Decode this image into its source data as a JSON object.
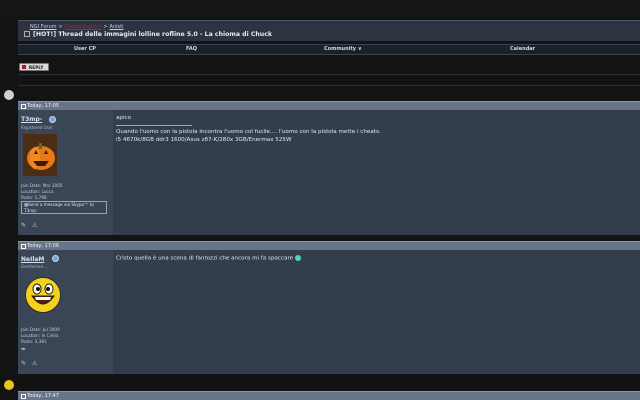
{
  "breadcrumb": {
    "forum": "NGI Forum",
    "section": "Comunicazioni",
    "subsection": "Anisti"
  },
  "thread": {
    "title": "[HOT!] Thread delle immagini lolline rofline 5.0 - La chioma di Chuck"
  },
  "navbar": {
    "items": [
      "User CP",
      "FAQ",
      "Community",
      "Calendar"
    ]
  },
  "actions": {
    "reply_label": "REPLY"
  },
  "colors": {
    "accent": "#c0163c",
    "post_header": "#67758a",
    "userinfo_bg": "#3a4555",
    "post_bg": "#333e4c"
  },
  "posts": [
    {
      "date": "Today, 17:05",
      "username": "T3mp-",
      "user_title": "Registered User",
      "avatar": "pumpkin-avatar",
      "join_date": "Join Date: Mar 2005",
      "location": "Location: Lucca",
      "posts": "Posts: 1,798",
      "skype_label": "Send a message via Skype™ to T3mp-",
      "body": [
        "apico",
        "Quando l'uomo con la pistola incontra l'uomo col fucile.... l'uomo con la pistola mette i cheats.",
        "i5 4670k/8GB ddr3 1600/Asus z87-K/280x 3GB/Enermax 525W"
      ]
    },
    {
      "date": "Today, 17:06",
      "username": "NeIlaM",
      "user_title": "Gentleman....",
      "avatar": "awesome-face-avatar",
      "join_date": "Join Date: Jul 2009",
      "location": "Location: In Cielia",
      "posts": "Posts: 3,381",
      "body": [
        "Cristo quella è una scena di fantozzi che ancora mi fa spaccare"
      ]
    }
  ],
  "next_post": {
    "date": "Today, 17:47"
  }
}
